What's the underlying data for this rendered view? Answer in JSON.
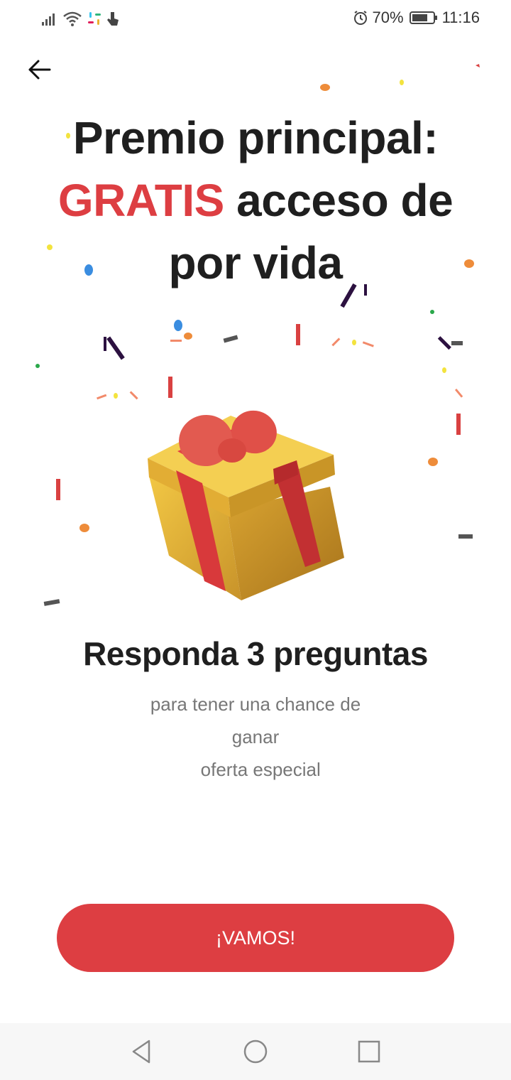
{
  "status_bar": {
    "battery_percent": "70%",
    "time": "11:16",
    "icons": [
      "signal-icon",
      "wifi-icon",
      "slack-icon",
      "touch-icon",
      "alarm-icon",
      "battery-icon"
    ]
  },
  "header": {
    "back_icon": "arrow-left-icon"
  },
  "headline": {
    "line1": "Premio principal:",
    "accent": "GRATIS",
    "line2_rest": " acceso de",
    "line3": "por vida"
  },
  "subhead": "Responda 3 preguntas",
  "description": {
    "line1": "para tener una chance de",
    "line2": "ganar",
    "line3": "  oferta especial"
  },
  "cta": {
    "label": "¡VAMOS!"
  },
  "nav_bar": {
    "icons": [
      "back-triangle-icon",
      "home-circle-icon",
      "recents-square-icon"
    ]
  },
  "colors": {
    "accent": "#dd3e42",
    "text": "#1f1f1f",
    "muted": "#777777"
  }
}
